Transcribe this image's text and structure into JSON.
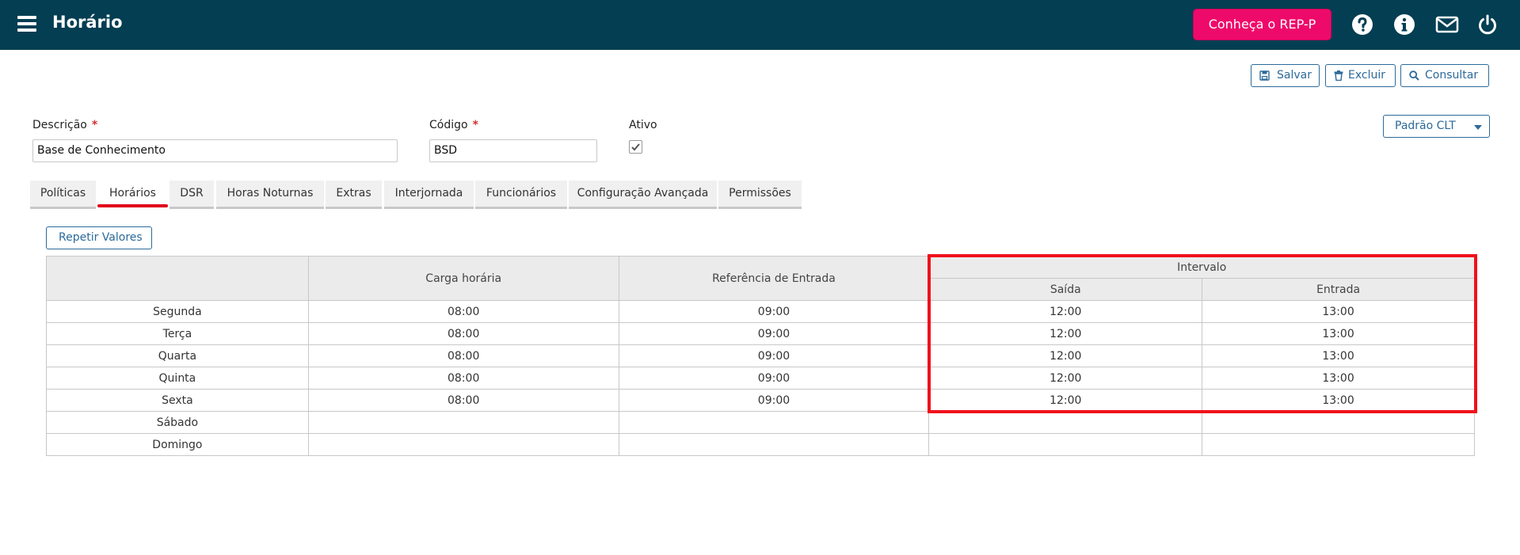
{
  "header": {
    "title": "Horário",
    "promo_label": "Conheça o REP-P",
    "icons": [
      "help-icon",
      "info-icon",
      "mail-icon",
      "power-icon"
    ]
  },
  "toolbar": {
    "save_label": "Salvar",
    "delete_label": "Excluir",
    "search_label": "Consultar",
    "preset_label": "Padrão CLT"
  },
  "form": {
    "description_label": "Descrição",
    "description_value": "Base de Conhecimento",
    "code_label": "Código",
    "code_value": "BSD",
    "active_label": "Ativo",
    "required_mark": "*"
  },
  "tabs": [
    "Políticas",
    "Horários",
    "DSR",
    "Horas Noturnas",
    "Extras",
    "Interjornada",
    "Funcionários",
    "Configuração Avançada",
    "Permissões"
  ],
  "active_tab": "Horários",
  "repeat_button": "Repetir Valores",
  "table": {
    "headers": {
      "workload": "Carga horária",
      "entry_ref": "Referência de Entrada",
      "interval": "Intervalo",
      "out": "Saída",
      "in": "Entrada"
    },
    "rows": [
      {
        "day": "Segunda",
        "workload": "08:00",
        "entry_ref": "09:00",
        "out": "12:00",
        "in": "13:00"
      },
      {
        "day": "Terça",
        "workload": "08:00",
        "entry_ref": "09:00",
        "out": "12:00",
        "in": "13:00"
      },
      {
        "day": "Quarta",
        "workload": "08:00",
        "entry_ref": "09:00",
        "out": "12:00",
        "in": "13:00"
      },
      {
        "day": "Quinta",
        "workload": "08:00",
        "entry_ref": "09:00",
        "out": "12:00",
        "in": "13:00"
      },
      {
        "day": "Sexta",
        "workload": "08:00",
        "entry_ref": "09:00",
        "out": "12:00",
        "in": "13:00"
      },
      {
        "day": "Sábado",
        "workload": "",
        "entry_ref": "",
        "out": "",
        "in": ""
      },
      {
        "day": "Domingo",
        "workload": "",
        "entry_ref": "",
        "out": "",
        "in": ""
      }
    ]
  },
  "colors": {
    "header_bg": "#033e53",
    "promo_bg": "#ee0a6a",
    "accent": "#2c6a9a",
    "highlight": "#f0101b"
  }
}
